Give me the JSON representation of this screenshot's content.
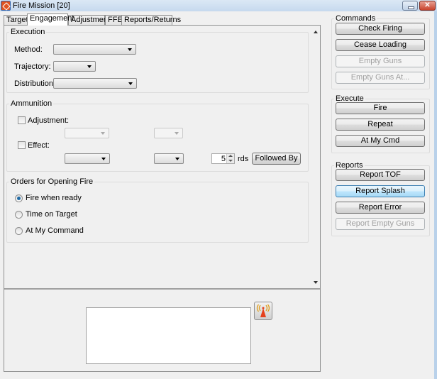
{
  "window": {
    "title": "Fire Mission [20]",
    "close_glyph": "✕"
  },
  "tabs": [
    {
      "label": "Target",
      "active": false
    },
    {
      "label": "Engagement",
      "active": true
    },
    {
      "label": "Adjustment",
      "active": false
    },
    {
      "label": "FFE",
      "active": false
    },
    {
      "label": "Reports/Returns",
      "active": false
    }
  ],
  "execution": {
    "title": "Execution",
    "method_label": "Method:",
    "method_value": "",
    "trajectory_label": "Trajectory:",
    "trajectory_value": "",
    "distribution_label": "Distribution:",
    "distribution_value": ""
  },
  "ammunition": {
    "title": "Ammunition",
    "adjustment_label": "Adjustment:",
    "adjustment_checked": false,
    "effect_label": "Effect:",
    "effect_checked": false,
    "rounds_value": "5",
    "rounds_unit": "rds",
    "followed_by_label": "Followed By"
  },
  "orders": {
    "title": "Orders for Opening Fire",
    "options": [
      {
        "label": "Fire when ready",
        "selected": true
      },
      {
        "label": "Time on Target",
        "selected": false
      },
      {
        "label": "At My Command",
        "selected": false
      }
    ]
  },
  "commands": {
    "title": "Commands",
    "buttons": [
      {
        "label": "Check Firing",
        "enabled": true
      },
      {
        "label": "Cease Loading",
        "enabled": true
      },
      {
        "label": "Empty Guns",
        "enabled": false
      },
      {
        "label": "Empty Guns At...",
        "enabled": false
      }
    ]
  },
  "execute": {
    "title": "Execute",
    "buttons": [
      {
        "label": "Fire",
        "enabled": true
      },
      {
        "label": "Repeat",
        "enabled": true
      },
      {
        "label": "At My Cmd",
        "enabled": true
      }
    ]
  },
  "reports": {
    "title": "Reports",
    "buttons": [
      {
        "label": "Report TOF",
        "enabled": true
      },
      {
        "label": "Report Splash",
        "enabled": true,
        "highlighted": true
      },
      {
        "label": "Report Error",
        "enabled": true
      },
      {
        "label": "Report Empty Guns",
        "enabled": false
      }
    ]
  },
  "message": {
    "text": ""
  }
}
